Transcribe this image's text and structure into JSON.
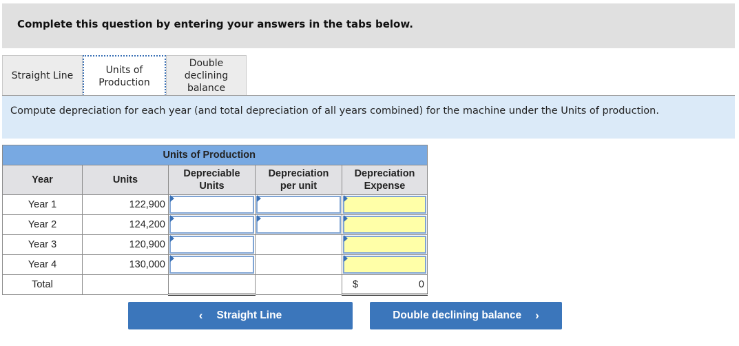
{
  "banner": {
    "text": "Complete this question by entering your answers in the tabs below."
  },
  "tabs": [
    {
      "label": "Straight Line",
      "active": false
    },
    {
      "label": "Units of Production",
      "active": true
    },
    {
      "label": "Double declining balance",
      "active": false
    }
  ],
  "instructions": "Compute depreciation for each year (and total depreciation of all years combined) for the machine under the Units of production.",
  "table": {
    "group_header": "Units of Production",
    "columns": {
      "year": "Year",
      "units": "Units",
      "depreciable_units": "Depreciable Units",
      "depreciation_per_unit": "Depreciation per unit",
      "depreciation_expense": "Depreciation Expense"
    },
    "rows": [
      {
        "year": "Year 1",
        "units": "122,900",
        "depreciable_units": "",
        "depreciation_per_unit": "",
        "depreciation_expense": ""
      },
      {
        "year": "Year 2",
        "units": "124,200",
        "depreciable_units": "",
        "depreciation_per_unit": "",
        "depreciation_expense": ""
      },
      {
        "year": "Year 3",
        "units": "120,900",
        "depreciable_units": "",
        "depreciation_expense": ""
      },
      {
        "year": "Year 4",
        "units": "130,000",
        "depreciable_units": "",
        "depreciation_expense": ""
      }
    ],
    "total": {
      "label": "Total",
      "currency": "$",
      "expense": "0"
    }
  },
  "nav": {
    "prev_label": "Straight Line",
    "next_label": "Double declining balance",
    "prev_icon": "‹",
    "next_icon": "›"
  },
  "colors": {
    "accent": "#3b76bb",
    "header_blue": "#78a9e2",
    "input_yellow": "#ffffa8",
    "instruction_bg": "#dbeaf8"
  }
}
